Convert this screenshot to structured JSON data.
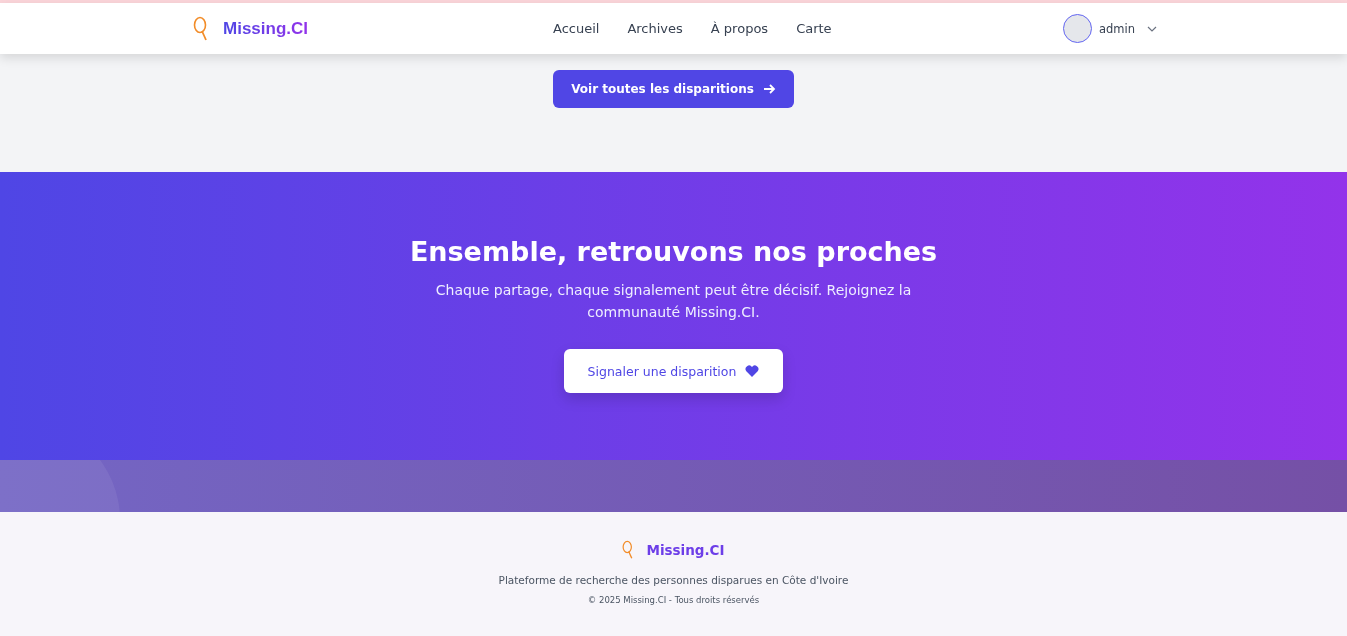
{
  "header": {
    "brand": "Missing.CI",
    "nav": [
      {
        "label": "Accueil"
      },
      {
        "label": "Archives"
      },
      {
        "label": "À propos"
      },
      {
        "label": "Carte"
      }
    ],
    "user": {
      "name": "admin"
    }
  },
  "browse_button": {
    "label": "Voir toutes les disparitions"
  },
  "cta": {
    "title": "Ensemble, retrouvons nos proches",
    "text": "Chaque partage, chaque signalement peut être décisif. Rejoignez la communauté Missing.CI.",
    "button": "Signaler une disparition"
  },
  "footer": {
    "brand": "Missing.CI",
    "tagline": "Plateforme de recherche des personnes disparues en Côte d'Ivoire",
    "copyright": "© 2025 Missing.CI - Tous droits réservés"
  }
}
